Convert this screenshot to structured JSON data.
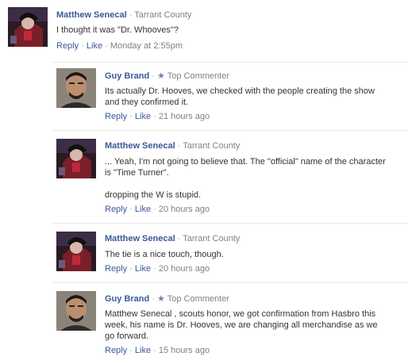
{
  "root": {
    "author": "Matthew Senecal",
    "location": "Tarrant County",
    "text": "I thought it was \"Dr. Whooves\"?",
    "reply_label": "Reply",
    "like_label": "Like",
    "time": "Monday at 2:55pm"
  },
  "replies": [
    {
      "author": "Guy Brand",
      "badge": "Top Commenter",
      "text": "Its actually Dr. Hooves, we checked with the people creating the show and they confirmed it.",
      "reply_label": "Reply",
      "like_label": "Like",
      "time": "21 hours ago",
      "avatar": "guy-avatar"
    },
    {
      "author": "Matthew Senecal",
      "location": "Tarrant County",
      "text": "... Yeah, I'm not going to believe that. The \"official\" name of the character is \"Time Turner\".\n\ndropping the W is stupid.",
      "reply_label": "Reply",
      "like_label": "Like",
      "time": "20 hours ago",
      "avatar": "matthew-avatar"
    },
    {
      "author": "Matthew Senecal",
      "location": "Tarrant County",
      "text": "The tie is a nice touch, though.",
      "reply_label": "Reply",
      "like_label": "Like",
      "time": "20 hours ago",
      "avatar": "matthew-avatar"
    },
    {
      "author": "Guy Brand",
      "badge": "Top Commenter",
      "text": "Matthew Senecal , scouts honor, we got confirmation from Hasbro this week, his name is Dr. Hooves, we are changing all merchandise as we go forward.",
      "reply_label": "Reply",
      "like_label": "Like",
      "time": "15 hours ago",
      "avatar": "guy-avatar"
    }
  ],
  "separator": " · ",
  "colors": {
    "link": "#3b5998",
    "meta": "#808080",
    "separator_line": "#e9e9e9"
  },
  "icons": {
    "star": "star-icon"
  }
}
